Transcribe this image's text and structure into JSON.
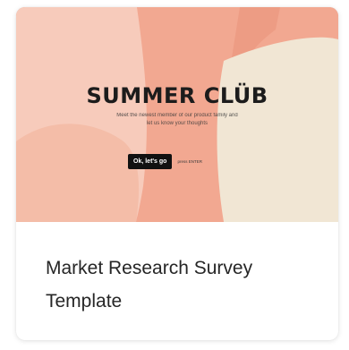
{
  "card": {
    "title": "Market Research Survey Template",
    "preview": {
      "heading": "SUMMER CLÜB",
      "subtitle": "Meet the newest member of our product family and let us know your thoughts",
      "button_label": "Ok, let's go",
      "hint": "press ENTER"
    }
  },
  "colors": {
    "preview_coral": "#f2a891",
    "preview_salmon": "#ec9c82",
    "preview_peach": "#f6c7b6",
    "preview_cream": "#f1e6d4",
    "button_bg": "#111111",
    "title_text": "#262626"
  }
}
